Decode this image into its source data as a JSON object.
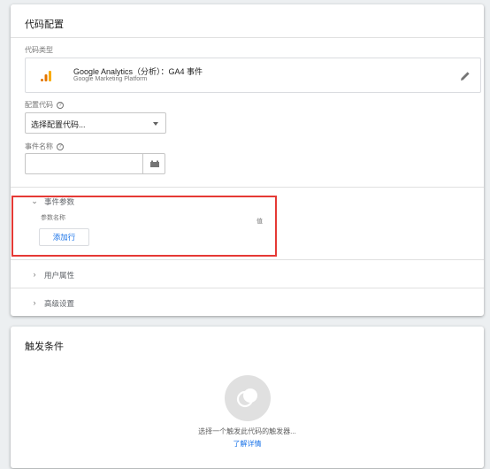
{
  "config_card": {
    "title": "代码配置",
    "tag_type_label": "代码类型",
    "tag_type_title": "Google Analytics（分析）：GA4 事件",
    "tag_type_subtitle": "Google Marketing Platform",
    "config_tag_label": "配置代码",
    "config_tag_select_value": "选择配置代码...",
    "event_name_label": "事件名称",
    "event_name_value": "",
    "help_glyph": "?",
    "sections": {
      "event_params": {
        "label": "事件参数",
        "expanded": true,
        "col_name": "参数名称",
        "col_value": "值",
        "add_row_label": "添加行"
      },
      "user_properties": {
        "label": "用户属性",
        "expanded": false
      },
      "advanced": {
        "label": "高级设置",
        "expanded": false
      }
    }
  },
  "trigger_card": {
    "title": "触发条件",
    "hint": "选择一个触发此代码的触发器...",
    "learn_more": "了解详情"
  },
  "colors": {
    "accent_blue": "#1a73e8",
    "highlight_red": "#e53935",
    "ga_orange": "#f9ab00",
    "ga_dark_orange": "#e37400"
  },
  "icons": {
    "ga_logo": "google-analytics-icon",
    "edit": "pencil-icon",
    "variable": "variable-brick-icon",
    "chevron_expanded": "chevron-down-icon",
    "chevron_collapsed": "chevron-right-icon",
    "trigger_placeholder": "trigger-circles-icon"
  }
}
